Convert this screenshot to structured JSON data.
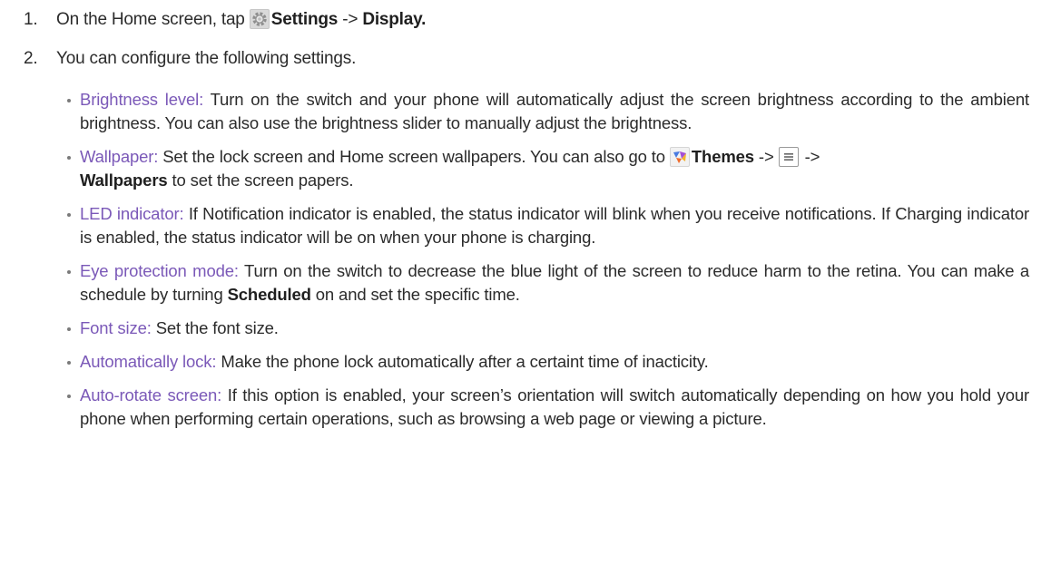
{
  "steps": [
    {
      "number": "1.",
      "text_pre": "On the Home screen, tap ",
      "settings_label": "Settings",
      "arrow": " -> ",
      "display_label": "Display."
    },
    {
      "number": "2.",
      "text": "You can configure the following settings."
    }
  ],
  "settings_items": [
    {
      "term": "Brightness level:",
      "text": " Turn on the switch and your phone will automatically adjust the screen brightness according to the ambient brightness. You can also use the brightness slider to manually adjust the brightness."
    },
    {
      "term": "Wallpaper:",
      "text_pre": " Set the lock screen and Home screen wallpapers. You can also go to ",
      "themes_label": "Themes",
      "arrow1": " -> ",
      "arrow2": " -> ",
      "wallpapers_label": "Wallpapers",
      "text_post": " to set the screen papers."
    },
    {
      "term": "LED indicator:",
      "text": " If Notification indicator is enabled, the status indicator will blink when you receive notifications. If Charging indicator is enabled, the status indicator will be on when your phone is charging."
    },
    {
      "term": "Eye protection mode:",
      "text_pre": " Turn on the switch to decrease the blue light of the screen to reduce harm to the retina. You can make a schedule by turning ",
      "scheduled_label": "Scheduled",
      "text_post": " on and set the specific time."
    },
    {
      "term": "Font size:",
      "text": " Set the font size."
    },
    {
      "term": "Automatically lock:",
      "text": " Make the phone lock automatically after a certaint time of inacticity."
    },
    {
      "term": "Auto-rotate screen:",
      "text": " If this option is enabled, your screen’s orientation will switch automatically depending on how you hold your phone when performing certain operations, such as browsing a web page or viewing a picture."
    }
  ],
  "icons": {
    "settings": "gear-icon",
    "themes": "themes-icon",
    "menu": "menu-icon"
  },
  "colors": {
    "term": "#7b59b8",
    "text": "#2b2b2b"
  }
}
